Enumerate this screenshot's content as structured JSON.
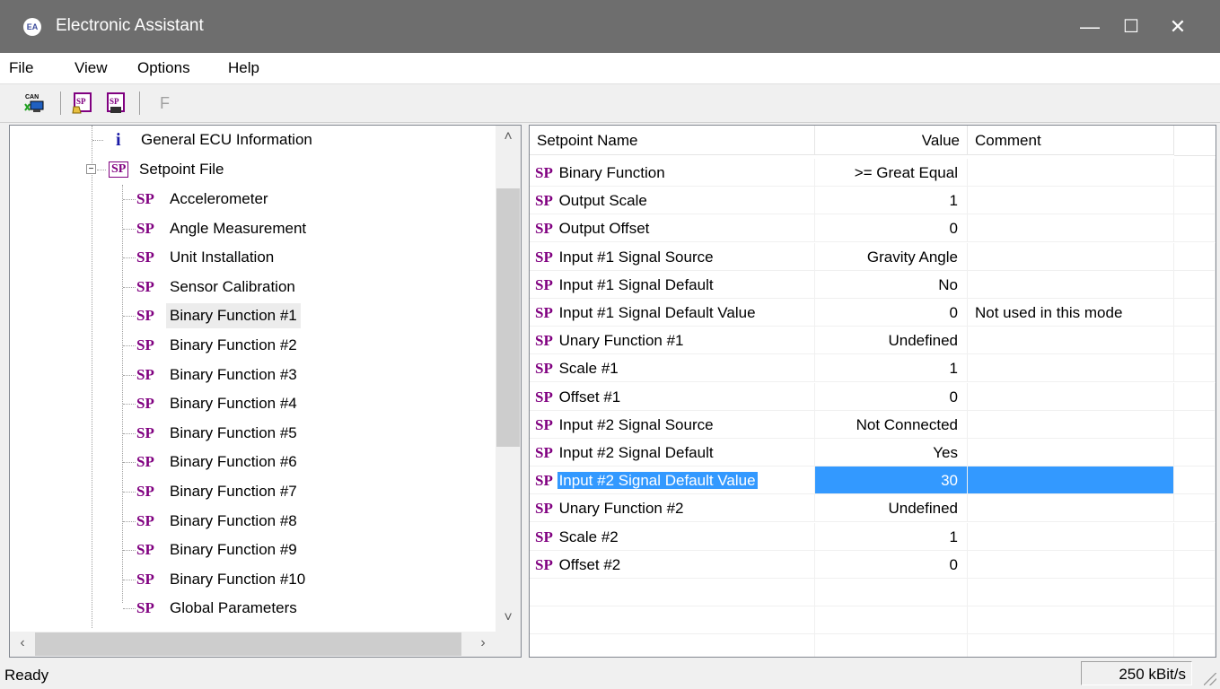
{
  "window": {
    "title": "Electronic Assistant",
    "app_icon": "EA",
    "minimize_glyph": "—",
    "maximize_glyph": "☐",
    "close_glyph": "✕"
  },
  "menu": [
    "File",
    "View",
    "Options",
    "Help"
  ],
  "toolbar": {
    "can_label": "CAN",
    "sp_label": "SP",
    "f_label": "F"
  },
  "tree": {
    "general_ecu": "General ECU Information",
    "setpoint_file": "Setpoint File",
    "expand_glyph": "−",
    "info_glyph": "i",
    "sp_glyph": "SP",
    "items": [
      "Accelerometer",
      "Angle Measurement",
      "Unit Installation",
      "Sensor Calibration",
      "Binary Function #1",
      "Binary Function #2",
      "Binary Function #3",
      "Binary Function #4",
      "Binary Function #5",
      "Binary Function #6",
      "Binary Function #7",
      "Binary Function #8",
      "Binary Function #9",
      "Binary Function #10",
      "Global Parameters"
    ],
    "selected_item": "Binary Function #1"
  },
  "grid": {
    "headers": {
      "name": "Setpoint Name",
      "value": "Value",
      "comment": "Comment"
    },
    "sp_glyph": "SP",
    "rows": [
      {
        "name": "Binary Function",
        "value": ">= Great Equal",
        "comment": ""
      },
      {
        "name": "Output Scale",
        "value": "1",
        "comment": ""
      },
      {
        "name": "Output Offset",
        "value": "0",
        "comment": ""
      },
      {
        "name": "Input #1 Signal Source",
        "value": "Gravity Angle",
        "comment": ""
      },
      {
        "name": "Input #1 Signal Default",
        "value": "No",
        "comment": ""
      },
      {
        "name": "Input #1 Signal Default Value",
        "value": "0",
        "comment": "Not used in this mode"
      },
      {
        "name": "Unary Function #1",
        "value": "Undefined",
        "comment": ""
      },
      {
        "name": "Scale #1",
        "value": "1",
        "comment": ""
      },
      {
        "name": "Offset #1",
        "value": "0",
        "comment": ""
      },
      {
        "name": "Input #2 Signal Source",
        "value": "Not Connected",
        "comment": ""
      },
      {
        "name": "Input #2 Signal Default",
        "value": "Yes",
        "comment": ""
      },
      {
        "name": "Input #2 Signal Default Value",
        "value": "30",
        "comment": ""
      },
      {
        "name": "Unary Function #2",
        "value": "Undefined",
        "comment": ""
      },
      {
        "name": "Scale #2",
        "value": "1",
        "comment": ""
      },
      {
        "name": "Offset #2",
        "value": "0",
        "comment": ""
      }
    ],
    "selected_row": "Input #2 Signal Default Value"
  },
  "status": {
    "text": "Ready",
    "baud": "250 kBit/s"
  },
  "colors": {
    "titlebar": "#6e6e6e",
    "selection": "#3399ff",
    "sp_purple": "#800080",
    "info_blue": "#1a1aa6"
  }
}
